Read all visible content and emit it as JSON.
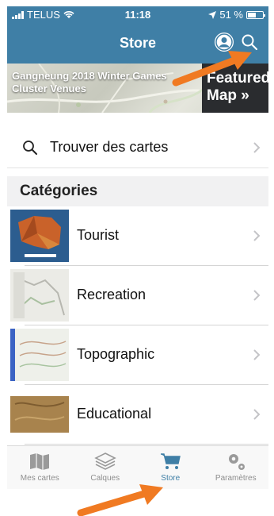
{
  "status": {
    "carrier": "TELUS",
    "time": "11:18",
    "battery": "51 %"
  },
  "nav": {
    "title": "Store"
  },
  "banner": {
    "caption_line1": "Gangneung 2018 Winter Games",
    "caption_line2": "Cluster Venues",
    "featured_line1": "Featured",
    "featured_line2": "Map »"
  },
  "find": {
    "label": "Trouver des cartes"
  },
  "categories": {
    "header": "Catégories",
    "items": [
      {
        "label": "Tourist"
      },
      {
        "label": "Recreation"
      },
      {
        "label": "Topographic"
      },
      {
        "label": "Educational"
      }
    ]
  },
  "tabs": [
    {
      "label": "Mes cartes",
      "icon": "map-icon"
    },
    {
      "label": "Calques",
      "icon": "layers-icon"
    },
    {
      "label": "Store",
      "icon": "cart-icon"
    },
    {
      "label": "Paramètres",
      "icon": "settings-icon"
    }
  ],
  "colors": {
    "accent": "#3f7fa6",
    "arrow": "#f07a22"
  }
}
